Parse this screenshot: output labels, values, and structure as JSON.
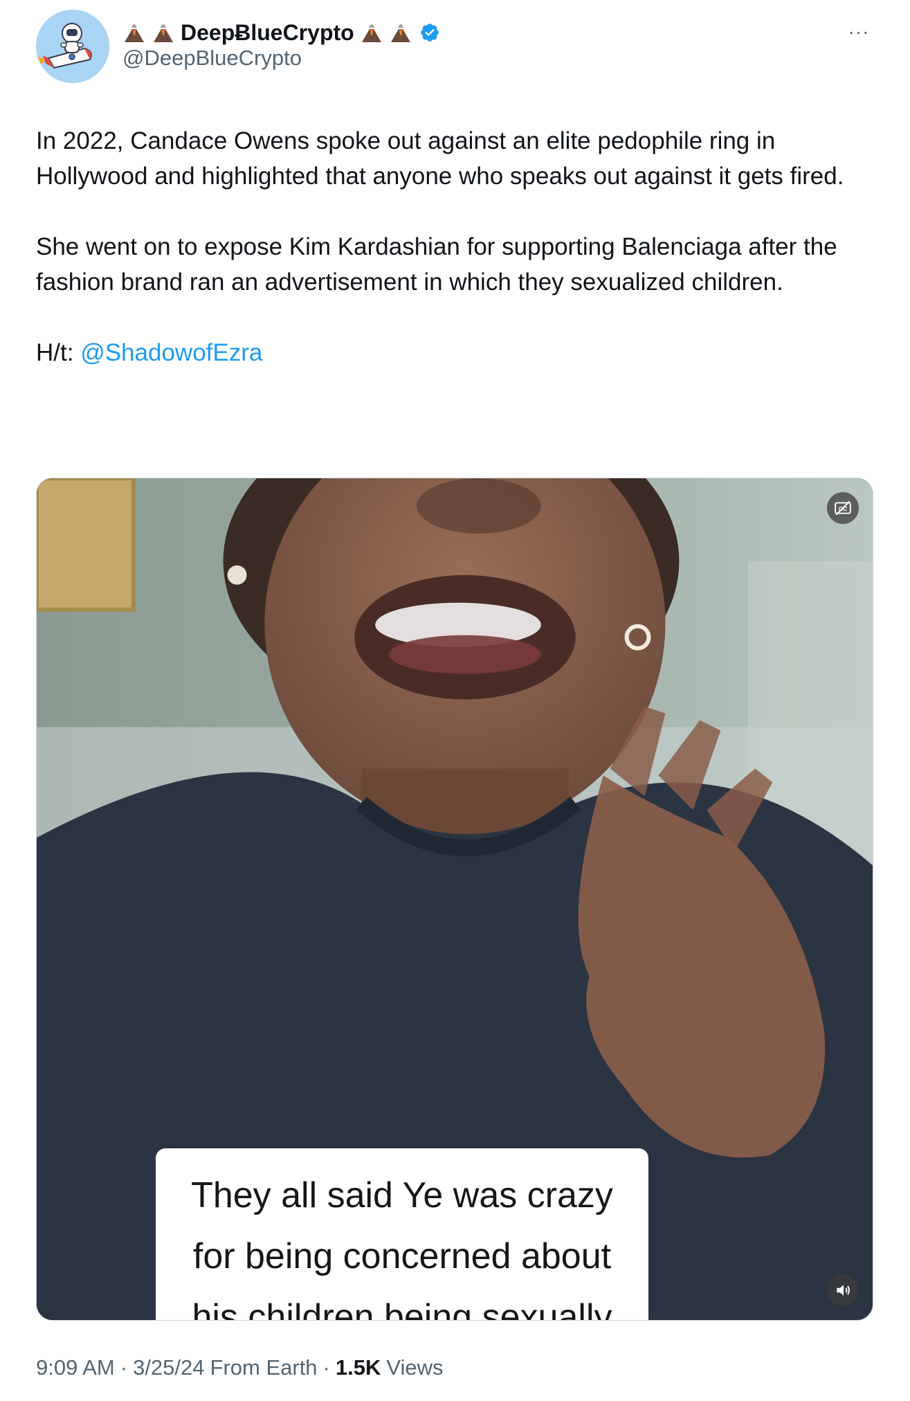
{
  "author": {
    "display_name": "DeepɃlueCrypto",
    "handle": "@DeepBlueCrypto",
    "emoji_left": [
      "volcano-icon",
      "volcano-icon"
    ],
    "emoji_right": [
      "volcano-icon",
      "volcano-icon"
    ],
    "verified": true,
    "verified_color": "#1d9bf0"
  },
  "more_icon": "···",
  "tweet": {
    "paragraph1": "In 2022, Candace Owens spoke out against an elite pedophile ring in Hollywood and highlighted that anyone who speaks out against it gets fired.",
    "paragraph2": "She went on to expose Kim Kardashian for supporting Balenciaga after the fashion brand ran an advertisement in which they sexualized children.",
    "ht_label": "H/t:",
    "ht_mention": "@ShadowofEzra"
  },
  "video": {
    "caption_lines": [
      "They all said Ye was crazy",
      "for being concerned about",
      "his children being sexually"
    ],
    "captions_button_icon": "captions-icon",
    "sound_button_icon": "speaker-icon"
  },
  "meta": {
    "time": "9:09 AM",
    "date": "3/25/24",
    "source": "From Earth",
    "views_count": "1.5K",
    "views_label": "Views",
    "separator": "·"
  },
  "colors": {
    "link": "#1d9bf0",
    "secondary_text": "#536471",
    "primary_text": "#0f1419"
  }
}
